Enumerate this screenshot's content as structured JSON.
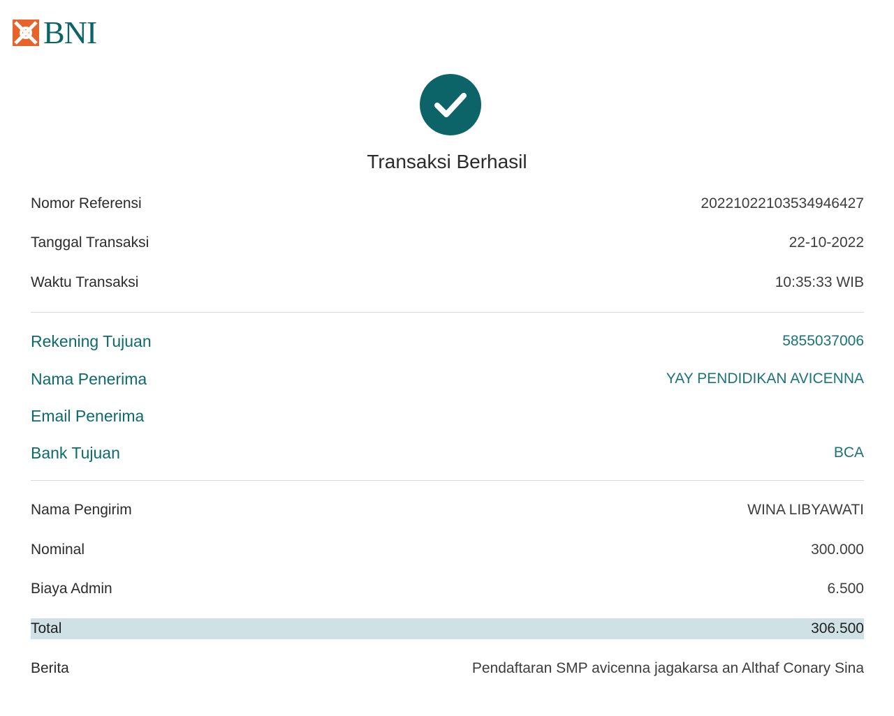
{
  "brand": {
    "name": "BNI",
    "colors": {
      "primary": "#0d6468",
      "accent": "#e8622c",
      "highlight": "#cfe1e4"
    }
  },
  "status": {
    "icon": "check-circle-icon",
    "title": "Transaksi Berhasil"
  },
  "transaction": {
    "reference": {
      "label": "Nomor Referensi",
      "value": "20221022103534946427"
    },
    "date": {
      "label": "Tanggal Transaksi",
      "value": "22-10-2022"
    },
    "time": {
      "label": "Waktu Transaksi",
      "value": "10:35:33 WIB"
    }
  },
  "recipient": {
    "account": {
      "label": "Rekening Tujuan",
      "value": "5855037006"
    },
    "name": {
      "label": "Nama Penerima",
      "value": "YAY PENDIDIKAN AVICENNA"
    },
    "email": {
      "label": "Email Penerima",
      "value": ""
    },
    "bank": {
      "label": "Bank Tujuan",
      "value": "BCA"
    }
  },
  "payment": {
    "sender": {
      "label": "Nama Pengirim",
      "value": "WINA LIBYAWATI"
    },
    "amount": {
      "label": "Nominal",
      "value": "300.000"
    },
    "fee": {
      "label": "Biaya Admin",
      "value": "6.500"
    },
    "total": {
      "label": "Total",
      "value": "306.500"
    },
    "note": {
      "label": "Berita",
      "value": "Pendaftaran SMP avicenna jagakarsa an Althaf Conary Sina"
    }
  }
}
